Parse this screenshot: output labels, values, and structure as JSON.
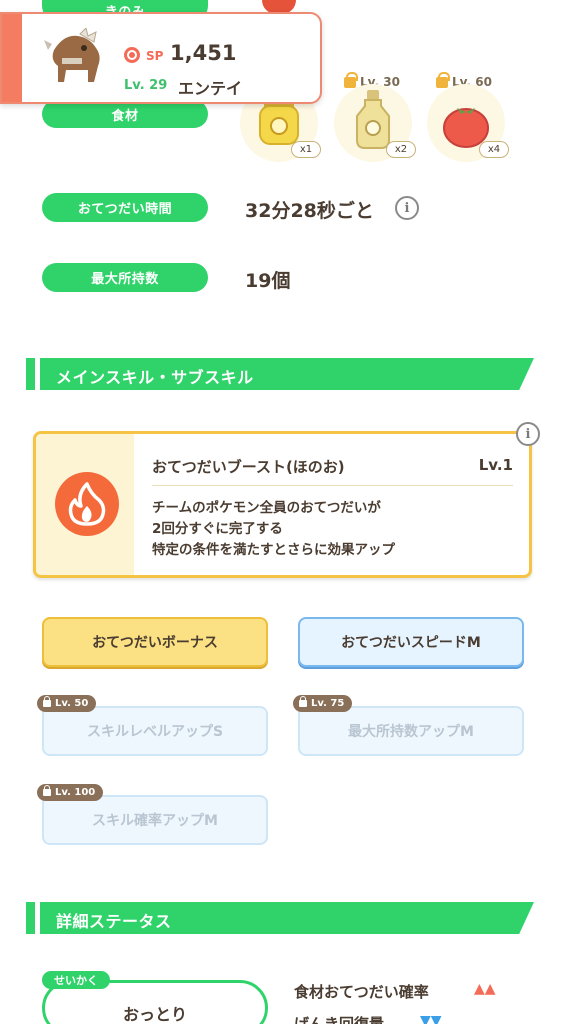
{
  "top_pills": {
    "berry": "きのみ",
    "ingredients": "食材"
  },
  "pokemon": {
    "sp_label": "SP",
    "sp_value": "1,451",
    "level": "Lv. 29",
    "name": "エンテイ"
  },
  "ingredients": [
    {
      "lock_level": "",
      "count": "x1",
      "color": "#f3d84a"
    },
    {
      "lock_level": "Lv. 30",
      "count": "x2",
      "color": "#ead27a"
    },
    {
      "lock_level": "Lv. 60",
      "count": "x4",
      "color": "#ef5a4a"
    }
  ],
  "stats": {
    "help_time_label": "おてつだい時間",
    "help_time_value": "32分28秒ごと",
    "info_glyph": "i",
    "max_carry_label": "最大所持数",
    "max_carry_value": "19個"
  },
  "sections": {
    "skills_title": "メインスキル・サブスキル",
    "details_title": "詳細ステータス"
  },
  "main_skill": {
    "name": "おてつだいブースト(ほのお)",
    "level": "Lv.1",
    "desc_line1": "チームのポケモン全員のおてつだいが",
    "desc_line2": "2回分すぐに完了する",
    "desc_line3": "特定の条件を満たすとさらに効果アップ",
    "icon": "fire-icon"
  },
  "sub_skills": [
    {
      "label": "おてつだいボーナス",
      "lock_level": "",
      "style": "gold"
    },
    {
      "label": "おてつだいスピードM",
      "lock_level": "",
      "style": "blue"
    },
    {
      "label": "スキルレベルアップS",
      "lock_level": "Lv. 50",
      "style": "locked"
    },
    {
      "label": "最大所持数アップM",
      "lock_level": "Lv. 75",
      "style": "locked"
    },
    {
      "label": "スキル確率アップM",
      "lock_level": "Lv. 100",
      "style": "locked"
    }
  ],
  "nature": {
    "tag": "せいかく",
    "name": "おっとり",
    "effect_up": "食材おてつだい確率",
    "effect_up_marks": "▲▲",
    "effect_down": "げんき回復量",
    "effect_down_marks": "▼▼"
  },
  "colors": {
    "accent_green": "#2fd36a",
    "skill_gold": "#f5c445",
    "fire_orange": "#f46a3a",
    "up_red": "#f46c57",
    "down_blue": "#3a9ee8"
  }
}
